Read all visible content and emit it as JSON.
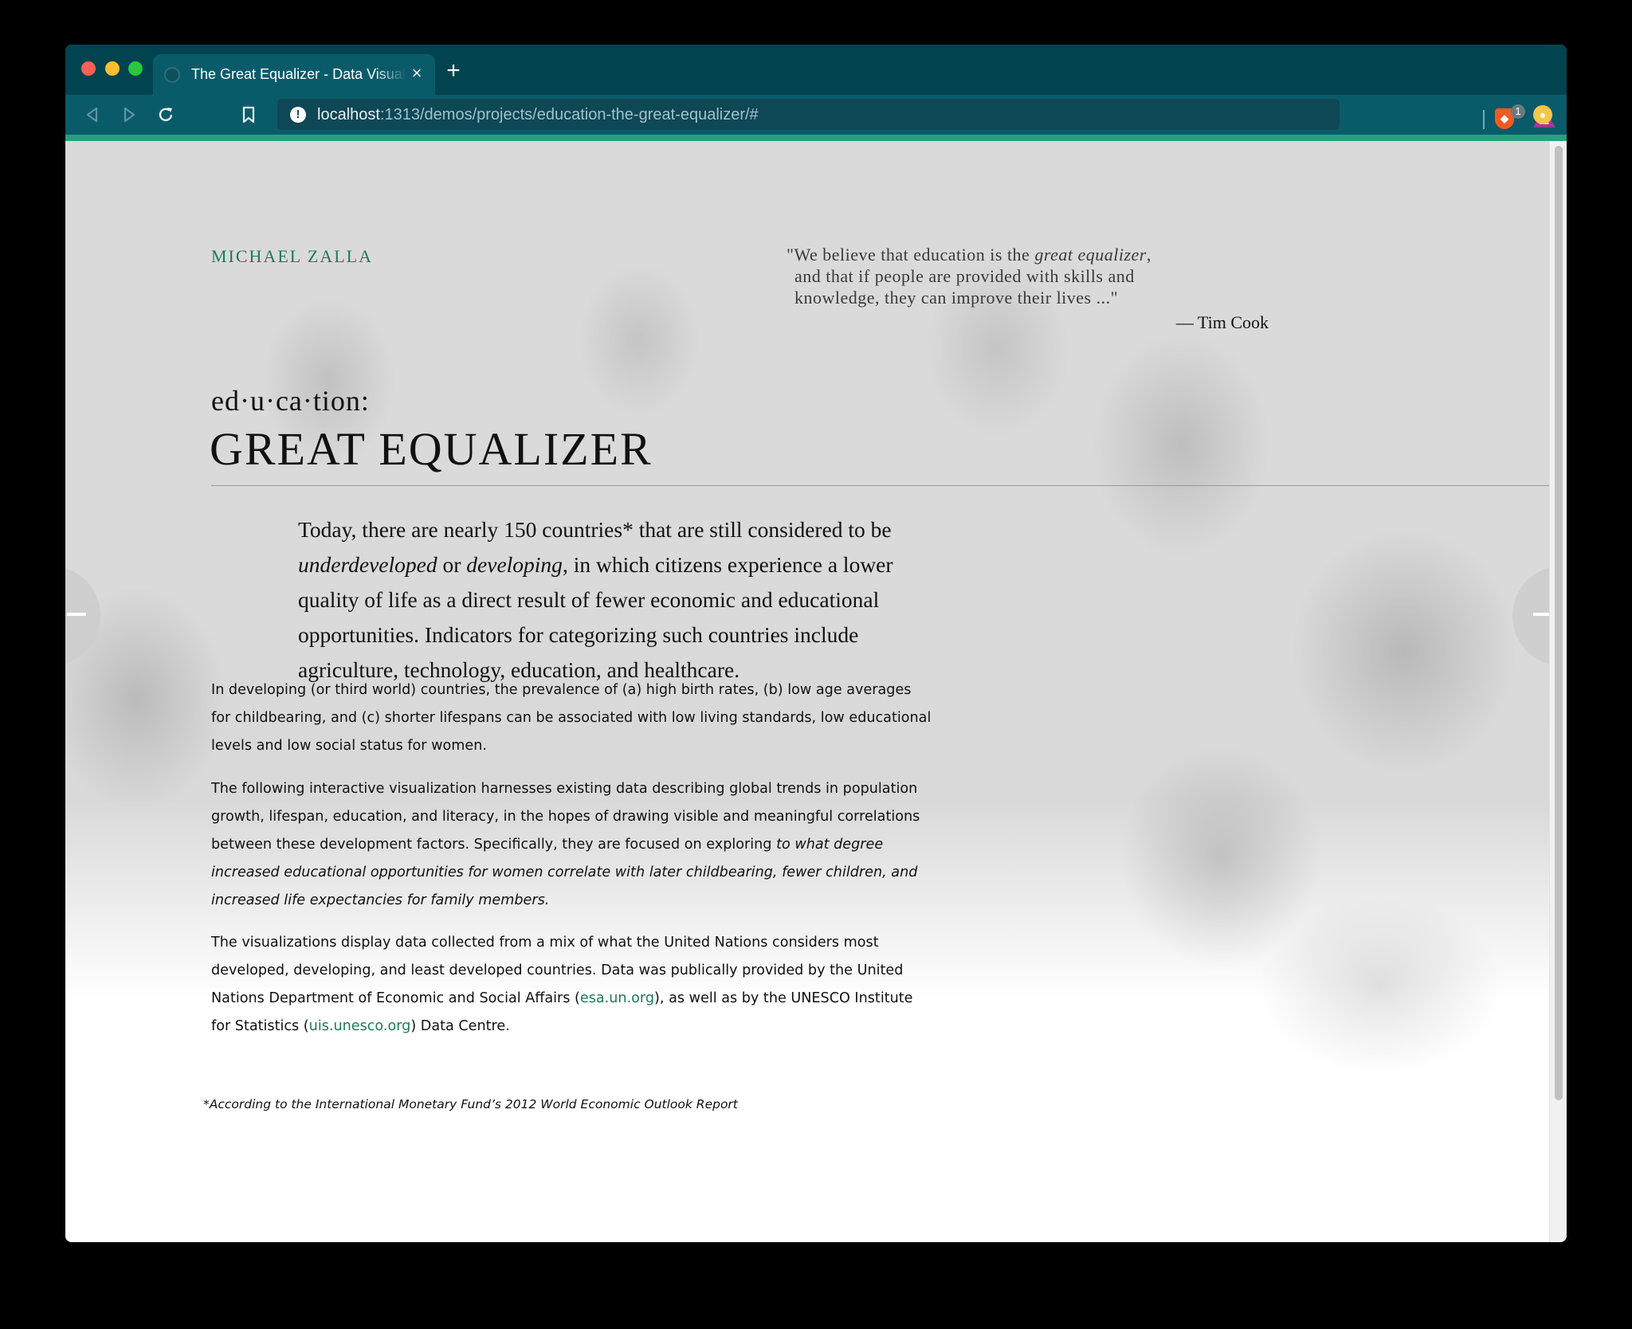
{
  "browser": {
    "tab_title": "The Great Equalizer - Data Visualization",
    "tab_close": "×",
    "new_tab": "+",
    "url_host": "localhost",
    "url_path": ":1313/demos/projects/education-the-great-equalizer/#",
    "brave_shields_count": "1",
    "icons": [
      "back-icon",
      "forward-icon",
      "reload-icon",
      "bookmark-icon",
      "site-info-icon",
      "brave-shields-icon",
      "brave-rewards-icon",
      "extension-icon"
    ]
  },
  "page": {
    "author": "MICHAEL ZALLA",
    "quote": {
      "line1_pre": "\"We believe that education is the ",
      "line1_em": "great equalizer",
      "line1_post": ",",
      "line2": "and that if people are provided with skills and",
      "line3": "knowledge, they can improve their lives ...\"",
      "attribution": "— Tim Cook"
    },
    "phonetic": "ed·u·ca·tion:",
    "headline": "GREAT EQUALIZER",
    "lede": {
      "line1": "Today, there are nearly 150 countries* that are still considered to be",
      "line2_em1": "underdeveloped",
      "line2_mid": " or ",
      "line2_em2": "developing",
      "line2_post": ", in which citizens experience a lower",
      "line3": "quality of life as a direct result of fewer economic and educational",
      "line4": "opportunities. Indicators for categorizing such countries include",
      "line5": "agriculture, technology, education, and healthcare."
    },
    "para1": {
      "line1": "In developing (or third world) countries, the prevalence of (a) high birth rates, (b) low age averages",
      "line2": "for childbearing, and (c) shorter lifespans can be associated with low living standards, low educational",
      "line3": "levels and low social status for women."
    },
    "para2": {
      "line1": "The following interactive visualization harnesses existing data describing global trends in population",
      "line2": "growth, lifespan, education, and literacy, in the hopes of drawing visible and meaningful correlations",
      "line3_pre": "between these development factors. Specifically, they are focused on exploring ",
      "line3_em": "to what degree",
      "line4_em": "increased educational opportunities for women correlate with later childbearing, fewer children, and",
      "line5_em": "increased life expectancies for family members."
    },
    "para3": {
      "line1": "The visualizations display data collected from a mix of what the United Nations considers most",
      "line2": "developed, developing, and least developed countries. Data was publically provided by the United",
      "line3_pre": "Nations Department of Economic and Social Affairs (",
      "line3_link": "esa.un.org",
      "line3_post": "), as well as by the UNESCO Institute",
      "line4_pre": "for Statistics (",
      "line4_link": "uis.unesco.org",
      "line4_post": ") Data Centre."
    },
    "footnote": "*According to the International Monetary Fund’s 2012 World Economic Outlook Report",
    "accent_color": "#26a17d",
    "link_color": "#1e7a5a"
  }
}
